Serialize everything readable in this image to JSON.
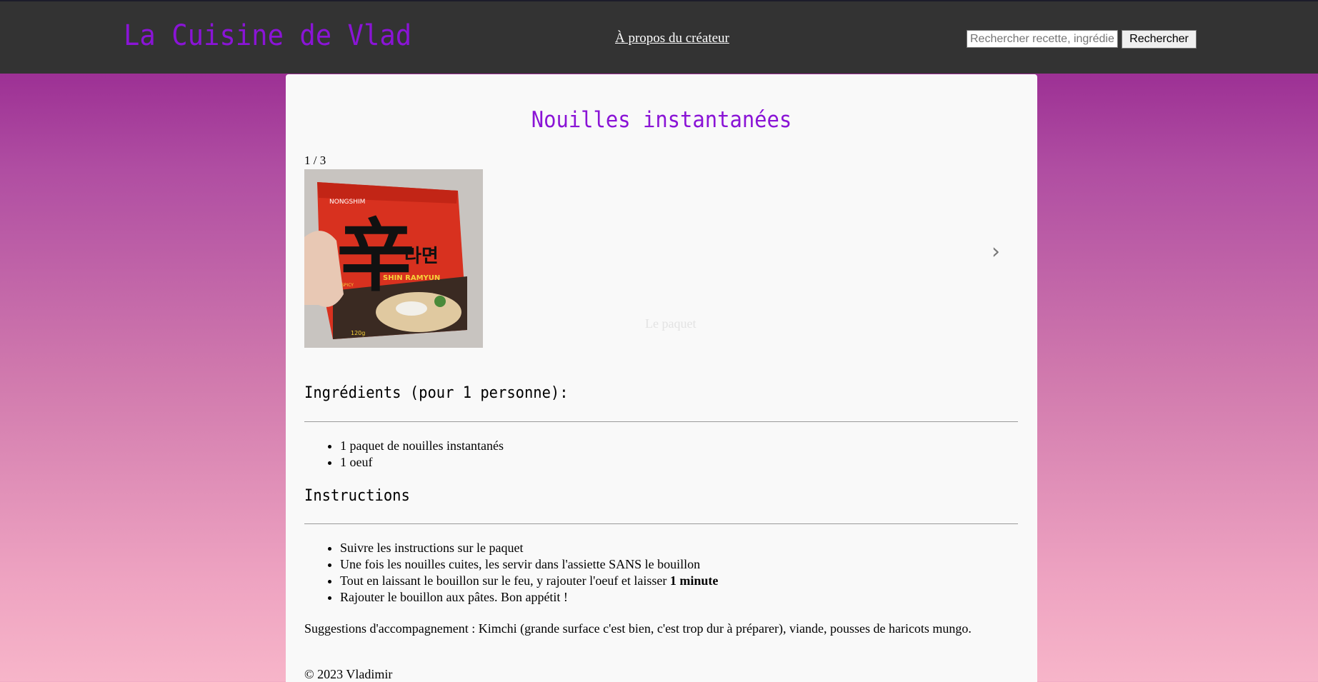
{
  "header": {
    "site_title": "La Cuisine de Vlad",
    "about_link": "À propos du créateur",
    "search_placeholder": "Rechercher recette, ingrédient",
    "search_button": "Rechercher"
  },
  "recipe": {
    "title": "Nouilles instantanées",
    "slideshow": {
      "counter": "1 / 3",
      "caption": "Le paquet",
      "next_icon": "chevron-right-icon",
      "image": "instant-noodle-package-photo",
      "image_text": {
        "brand": "NONGSHIM",
        "hanja": "辛",
        "hangul": "라면",
        "product": "SHIN RAMYUN",
        "spicy": "SPICY",
        "weight": "120g"
      }
    },
    "ingredients_heading": "Ingrédients (pour 1 personne):",
    "ingredients": [
      "1 paquet de nouilles instantanés",
      "1 oeuf"
    ],
    "instructions_heading": "Instructions",
    "instructions": [
      {
        "text": "Suivre les instructions sur le paquet",
        "bold": ""
      },
      {
        "text": "Une fois les nouilles cuites, les servir dans l'assiette SANS le bouillon",
        "bold": ""
      },
      {
        "text": "Tout en laissant le bouillon sur le feu, y rajouter l'oeuf et laisser ",
        "bold": "1 minute"
      },
      {
        "text": "Rajouter le bouillon aux pâtes. Bon appétit !",
        "bold": ""
      }
    ],
    "suggestions": "Suggestions d'accompagnement : Kimchi (grande surface c'est bien, c'est trop dur à préparer), viande, pousses de haricots mungo.",
    "copyright": "© 2023 Vladimir"
  },
  "colors": {
    "accent": "#8a14d6",
    "header_bg": "#333333",
    "card_bg": "#f9f9f9"
  }
}
